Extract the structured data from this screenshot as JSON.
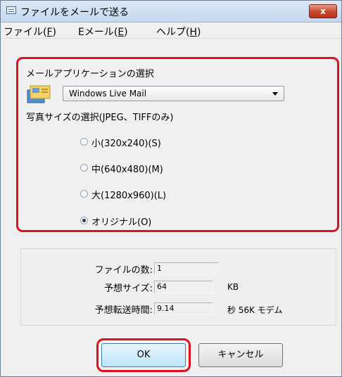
{
  "window": {
    "title": "ファイルをメールで送る",
    "close_label": "x"
  },
  "menu": [
    {
      "text": "ファイル(",
      "key": "F",
      "close": ")"
    },
    {
      "text": "Eメール(",
      "key": "E",
      "close": ")"
    },
    {
      "text": "ヘルプ(",
      "key": "H",
      "close": ")"
    }
  ],
  "mail_app": {
    "label": "メールアプリケーションの選択",
    "selected": "Windows Live Mail",
    "icon": "mail-app-icon"
  },
  "photo_size": {
    "label": "写真サイズの選択(JPEG、TIFFのみ)",
    "options": [
      {
        "label": "小(320x240)(S)",
        "selected": false
      },
      {
        "label": "中(640x480)(M)",
        "selected": false
      },
      {
        "label": "大(1280x960)(L)",
        "selected": false
      },
      {
        "label": "オリジナル(O)",
        "selected": true
      }
    ]
  },
  "info": {
    "file_count_label": "ファイルの数:",
    "file_count": "1",
    "expected_size_label": "予想サイズ:",
    "expected_size": "64",
    "expected_size_unit": "KB",
    "transfer_time_label": "予想転送時間:",
    "transfer_time": "9.14",
    "transfer_time_unit": "秒 56K モデム"
  },
  "buttons": {
    "ok": "OK",
    "cancel": "キャンセル"
  },
  "colors": {
    "highlight": "#e0101e"
  }
}
